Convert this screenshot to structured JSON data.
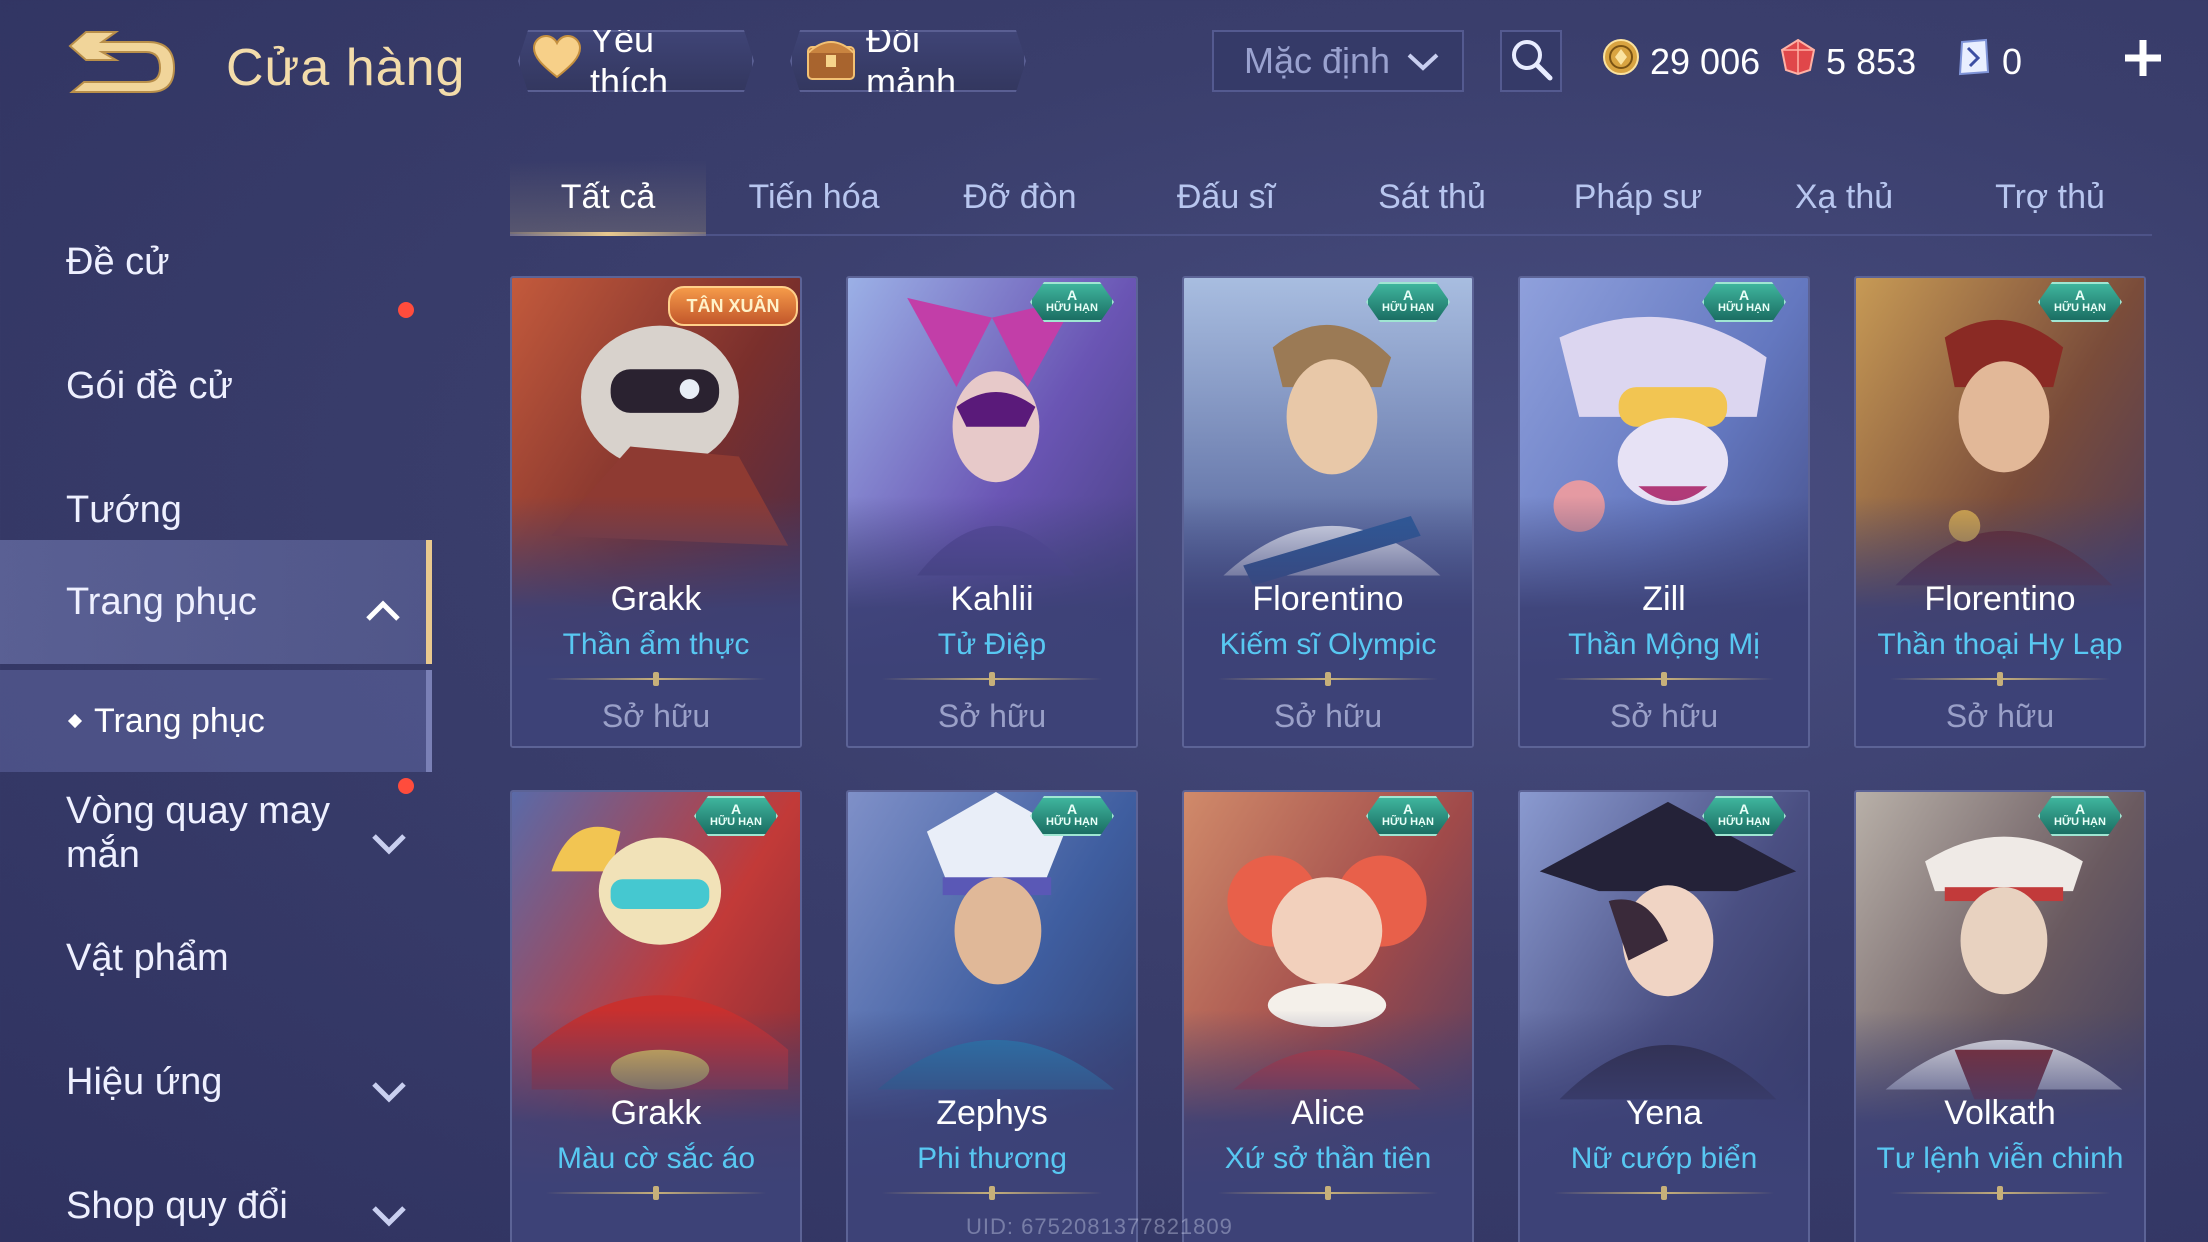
{
  "header": {
    "title": "Cửa hàng",
    "favorites_label": "Yêu thích",
    "shards_label": "Đổi mảnh",
    "sort_value": "Mặc định",
    "gold": "29 006",
    "gems": "5 853",
    "vouchers": "0"
  },
  "sidebar": {
    "items": [
      {
        "label": "Đề cử"
      },
      {
        "label": "Gói đề cử"
      },
      {
        "label": "Tướng"
      },
      {
        "label": "Trang phục"
      },
      {
        "label": "Trang phục"
      },
      {
        "label": "Vòng quay may mắn"
      },
      {
        "label": "Vật phẩm"
      },
      {
        "label": "Hiệu ứng"
      },
      {
        "label": "Shop quy đổi"
      }
    ]
  },
  "tabs": [
    {
      "label": "Tất cả"
    },
    {
      "label": "Tiến hóa"
    },
    {
      "label": "Đỡ đòn"
    },
    {
      "label": "Đấu sĩ"
    },
    {
      "label": "Sát thủ"
    },
    {
      "label": "Pháp sư"
    },
    {
      "label": "Xạ thủ"
    },
    {
      "label": "Trợ thủ"
    }
  ],
  "badges": {
    "limited_letter": "A",
    "limited_text": "HỮU HẠN",
    "event_text": "TÂN XUÂN"
  },
  "cards": [
    {
      "hero": "Grakk",
      "skin": "Thần ẩm thực",
      "status": "Sở hữu"
    },
    {
      "hero": "Kahlii",
      "skin": "Tử Điệp",
      "status": "Sở hữu"
    },
    {
      "hero": "Florentino",
      "skin": "Kiếm sĩ Olympic",
      "status": "Sở hữu"
    },
    {
      "hero": "Zill",
      "skin": "Thần Mộng Mị",
      "status": "Sở hữu"
    },
    {
      "hero": "Florentino",
      "skin": "Thần thoại Hy Lạp",
      "status": "Sở hữu"
    },
    {
      "hero": "Grakk",
      "skin": "Màu cờ sắc áo",
      "status": ""
    },
    {
      "hero": "Zephys",
      "skin": "Phi thương",
      "status": ""
    },
    {
      "hero": "Alice",
      "skin": "Xứ sở thần tiên",
      "status": ""
    },
    {
      "hero": "Yena",
      "skin": "Nữ cướp biển",
      "status": ""
    },
    {
      "hero": "Volkath",
      "skin": "Tư lệnh viễn chinh",
      "status": ""
    }
  ],
  "footer": {
    "uid": "UID: 6752081377821809"
  },
  "colors": {
    "accent_gold": "#e9c98e",
    "skin_name": "#58c8f2",
    "notification": "#ff4c3c"
  }
}
